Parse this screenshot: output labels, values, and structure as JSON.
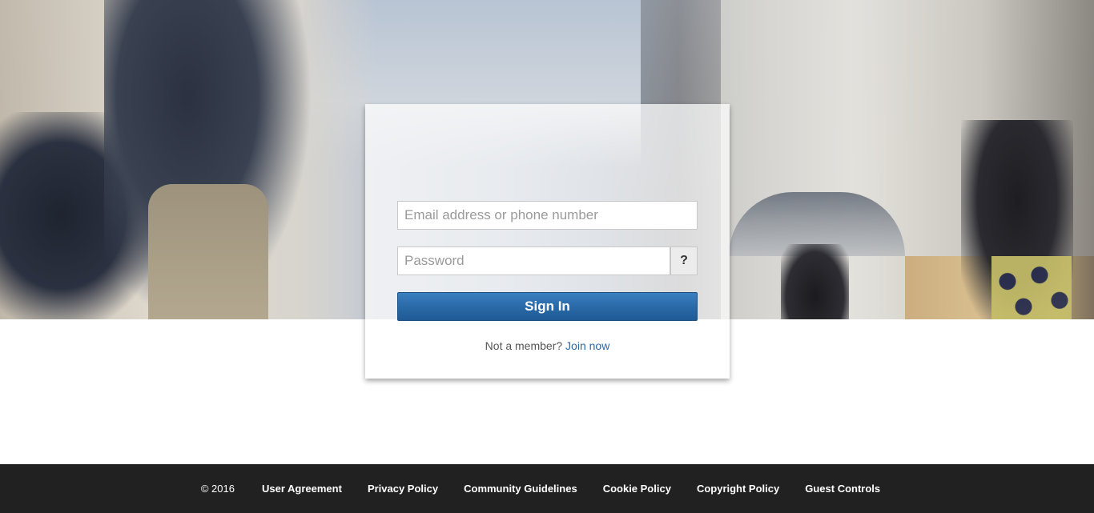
{
  "login": {
    "email_placeholder": "Email address or phone number",
    "password_placeholder": "Password",
    "password_help_label": "?",
    "signin_label": "Sign In",
    "not_member_text": "Not a member?",
    "join_label": "Join now"
  },
  "footer": {
    "copyright": "© 2016",
    "links": [
      {
        "label": "User Agreement"
      },
      {
        "label": "Privacy Policy"
      },
      {
        "label": "Community Guidelines"
      },
      {
        "label": "Cookie Policy"
      },
      {
        "label": "Copyright Policy"
      },
      {
        "label": "Guest Controls"
      }
    ]
  },
  "colors": {
    "primary_button": "#2a6aa8",
    "link": "#2a6aa8",
    "footer_bg": "#212121"
  }
}
